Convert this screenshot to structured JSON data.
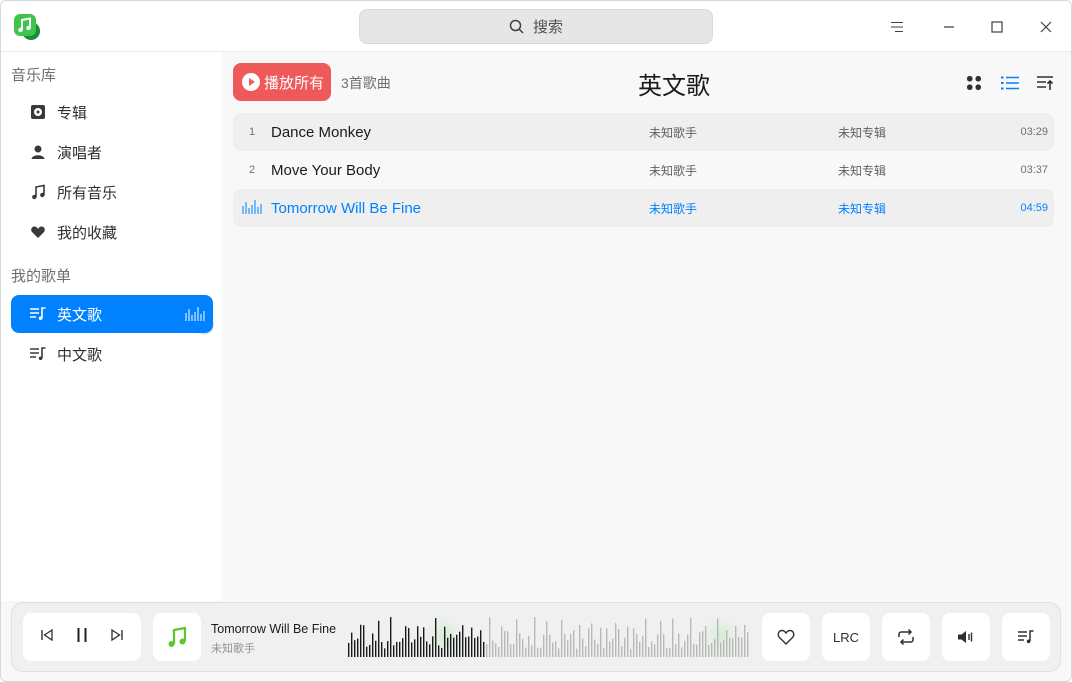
{
  "titlebar": {
    "search_placeholder": "搜索"
  },
  "sidebar": {
    "library_header": "音乐库",
    "library_items": [
      {
        "label": "专辑",
        "icon": "album-icon"
      },
      {
        "label": "演唱者",
        "icon": "person-icon"
      },
      {
        "label": "所有音乐",
        "icon": "music-note-icon"
      },
      {
        "label": "我的收藏",
        "icon": "heart-icon"
      }
    ],
    "playlists_header": "我的歌单",
    "playlists": [
      {
        "label": "英文歌",
        "icon": "playlist-icon",
        "active": true
      },
      {
        "label": "中文歌",
        "icon": "playlist-icon",
        "active": false
      }
    ]
  },
  "main": {
    "play_all_label": "播放所有",
    "song_count": "3首歌曲",
    "title": "英文歌",
    "tracks": [
      {
        "num": "1",
        "title": "Dance Monkey",
        "artist": "未知歌手",
        "album": "未知专辑",
        "duration": "03:29",
        "playing": false
      },
      {
        "num": "2",
        "title": "Move Your Body",
        "artist": "未知歌手",
        "album": "未知专辑",
        "duration": "03:37",
        "playing": false
      },
      {
        "num": "",
        "title": "Tomorrow Will Be Fine",
        "artist": "未知歌手",
        "album": "未知专辑",
        "duration": "04:59",
        "playing": true
      }
    ]
  },
  "player": {
    "track_title": "Tomorrow Will Be Fine",
    "artist": "未知歌手",
    "lrc_label": "LRC"
  },
  "colors": {
    "accent": "#0081ff",
    "play_all": "#ee5a5a",
    "logo_green": "#3fc54a"
  }
}
